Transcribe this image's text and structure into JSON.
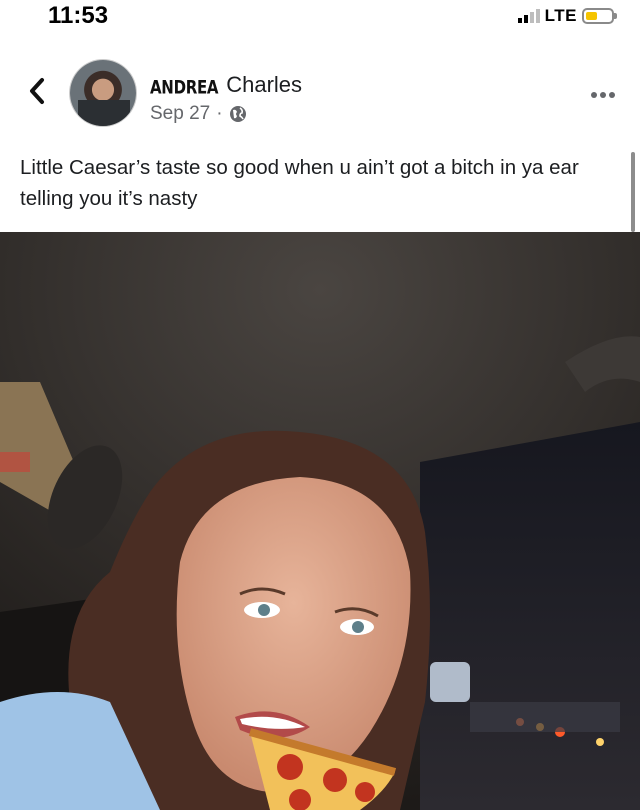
{
  "status_bar": {
    "time": "11:53",
    "network": "LTE",
    "battery_color": "#f5c400"
  },
  "post": {
    "author_first": "ANDREA",
    "author_last": "Charles",
    "date": "Sep 27",
    "separator": "·",
    "audience_icon": "globe-icon",
    "text": "Little Caesar’s taste so good when u ain’t got a bitch in ya ear telling you it’s nasty",
    "more_icon": "more-dots-icon"
  },
  "photo": {
    "subject": "selfie in car with pizza slice sticker",
    "sticker": "pepperoni-pizza-slice"
  }
}
